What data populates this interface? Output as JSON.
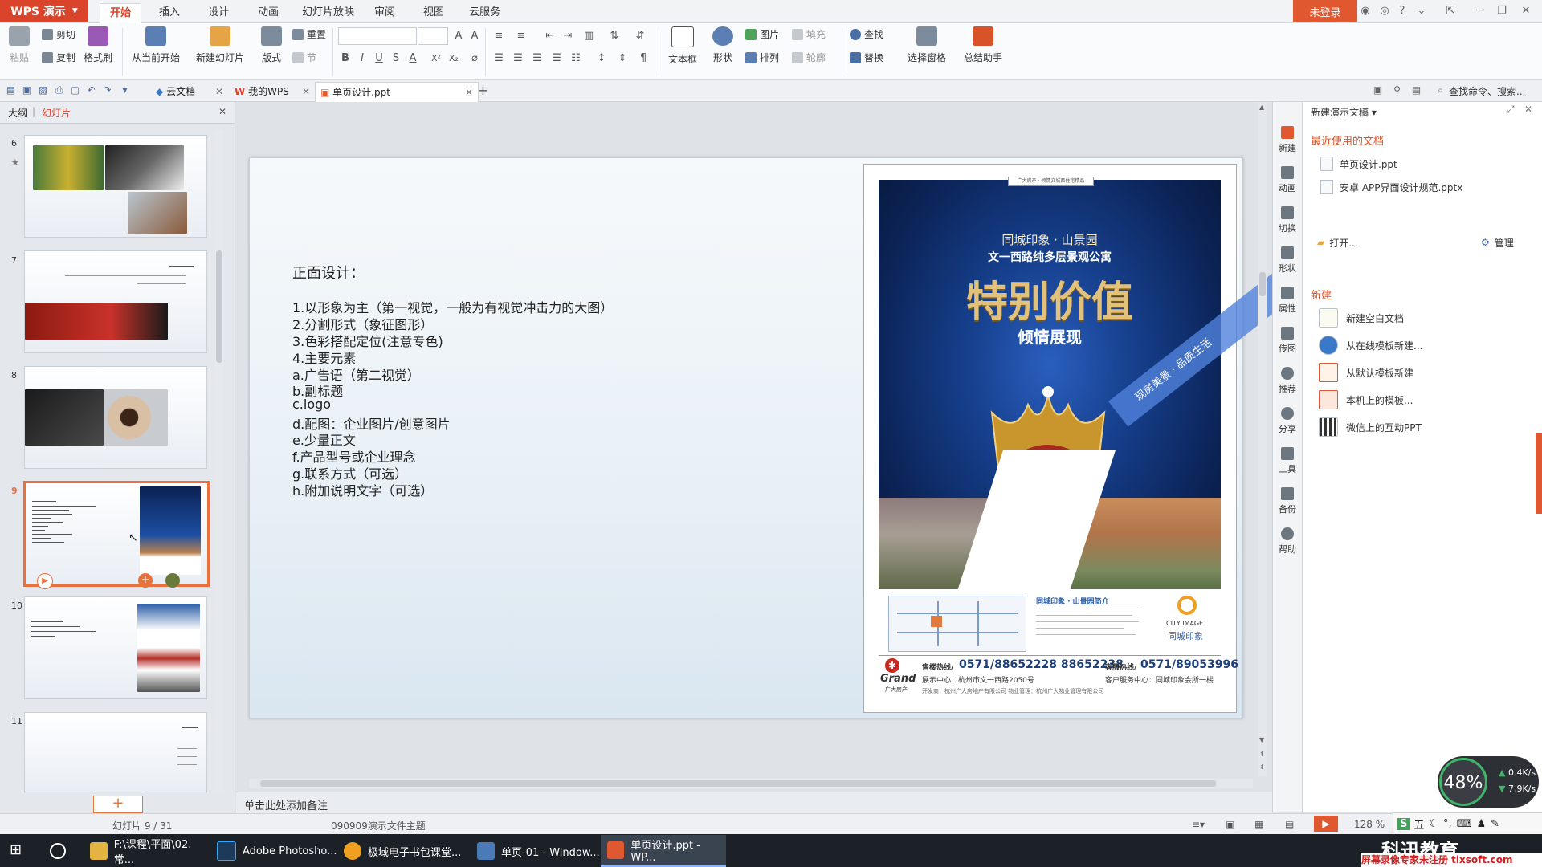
{
  "app": {
    "name": "WPS 演示",
    "login_label": "未登录",
    "menu_tabs": [
      "开始",
      "插入",
      "设计",
      "动画",
      "幻灯片放映",
      "审阅",
      "视图",
      "云服务"
    ],
    "active_menu_tab": "开始"
  },
  "ribbon": {
    "paste": "粘贴",
    "cut": "剪切",
    "copy": "复制",
    "format_painter": "格式刷",
    "from_current": "从当前开始",
    "new_slide": "新建幻灯片",
    "layout": "版式",
    "reset": "重置",
    "section": "节",
    "text_box": "文本框",
    "shape": "形状",
    "picture": "图片",
    "fill": "填充",
    "arrange": "排列",
    "outline": "轮廓",
    "find": "查找",
    "replace": "替换",
    "selection_pane": "选择窗格",
    "summary_assistant": "总结助手",
    "format_buttons": [
      "B",
      "I",
      "U",
      "S",
      "A",
      "X²",
      "X₂"
    ]
  },
  "tabbar": {
    "tabs": [
      {
        "label": "云文档"
      },
      {
        "label": "我的WPS"
      },
      {
        "label": "单页设计.ppt"
      }
    ],
    "search_placeholder": "查找命令、搜索..."
  },
  "left_panel": {
    "tab_outline": "大纲",
    "tab_slides": "幻灯片",
    "slide_numbers": [
      "6",
      "7",
      "8",
      "9",
      "10",
      "11"
    ],
    "selected_slide": "9"
  },
  "slide": {
    "title": "正面设计：",
    "bullets": [
      "1.以形象为主（第一视觉，一般为有视觉冲击力的大图）",
      "2.分割形式（象征图形）",
      "3.色彩搭配定位(注意专色)",
      "4.主要元素",
      "a.广告语（第二视觉）",
      "b.副标题",
      "c.logo",
      "d.配图：企业图片/创意图片",
      "e.少量正文",
      "f.产品型号或企业理念",
      "g.联系方式（可选）",
      "h.附加说明文字（可选）"
    ]
  },
  "poster": {
    "badge": "广大房产 · 倾情文城西住宅精品",
    "line1": "同城印象 · 山景园",
    "line2": "文一西路纯多层景观公寓",
    "headline": "特别价值",
    "subhead": "倾情展现",
    "ribbon_text": "现房美景 · 品质生活",
    "intro_title": "同城印象 · 山景园简介",
    "brand": "CITY IMAGE",
    "brand_cn": "同城印象",
    "grand": "Grand",
    "grand_cn": "广大房产",
    "sales_label": "售楼热线/",
    "sales_phone": "0571/88652228  88652238",
    "service_label": "客服热线/",
    "service_phone": "0571/89053996",
    "showroom": "展示中心：杭州市文一西路2050号",
    "service_center": "客户服务中心：同城印象会所一楼",
    "developer": "开发商：杭州广大房地产有限公司 物业管理：杭州广大物业管理有限公司"
  },
  "notes": {
    "placeholder": "单击此处添加备注"
  },
  "side_strip": [
    "新建",
    "动画",
    "切换",
    "形状",
    "属性",
    "传图",
    "推荐",
    "分享",
    "工具",
    "备份",
    "帮助"
  ],
  "taskpane": {
    "title": "新建演示文稿",
    "recent_header": "最近使用的文档",
    "recent_files": [
      "单页设计.ppt",
      "安卓 APP界面设计规范.pptx"
    ],
    "open": "打开...",
    "manage": "管理",
    "new_header": "新建",
    "new_items": [
      "新建空白文档",
      "从在线模板新建...",
      "从默认模板新建",
      "本机上的模板...",
      "微信上的互动PPT"
    ]
  },
  "speed": {
    "percent": "48%",
    "up": "0.4K/s",
    "down": "7.9K/s"
  },
  "status": {
    "slide_counter": "幻灯片 9 / 31",
    "theme": "090909演示文件主题",
    "zoom": "128 %"
  },
  "taskbar": {
    "items": [
      {
        "label": "F:\\课程\\平面\\02.常..."
      },
      {
        "label": "Adobe Photosho..."
      },
      {
        "label": "极域电子书包课堂..."
      },
      {
        "label": "单页-01 - Window..."
      },
      {
        "label": "单页设计.ppt - WP..."
      }
    ],
    "ime": "五",
    "watermark_logo": "科迅教育",
    "watermark_text": "屏幕录像专家未注册  tlxsoft.com"
  },
  "colors": {
    "accent": "#d9442b",
    "selection": "#e8713c",
    "taskpane_section": "#d9532a"
  }
}
